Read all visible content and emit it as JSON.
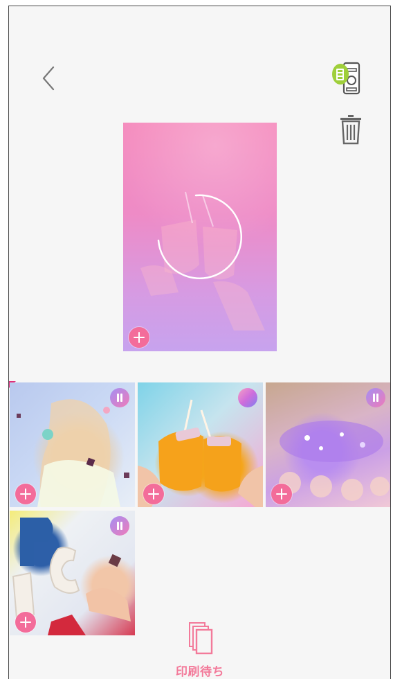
{
  "header": {
    "back_icon": "chevron-left-icon",
    "printer_icon": "printer-connected-icon",
    "trash_icon": "trash-icon"
  },
  "preview": {
    "progress_shown": 0.55,
    "add_icon": "plus-icon"
  },
  "queue": [
    {
      "status": "paused"
    },
    {
      "status": "printing"
    },
    {
      "status": "paused"
    },
    {
      "status": "paused"
    }
  ],
  "bottom_tab": {
    "label": "印刷待ち",
    "icon": "stacked-photos-icon"
  },
  "colors": {
    "accent": "#f36c9a",
    "label": "#f37a9a",
    "background": "#f6f6f6"
  }
}
